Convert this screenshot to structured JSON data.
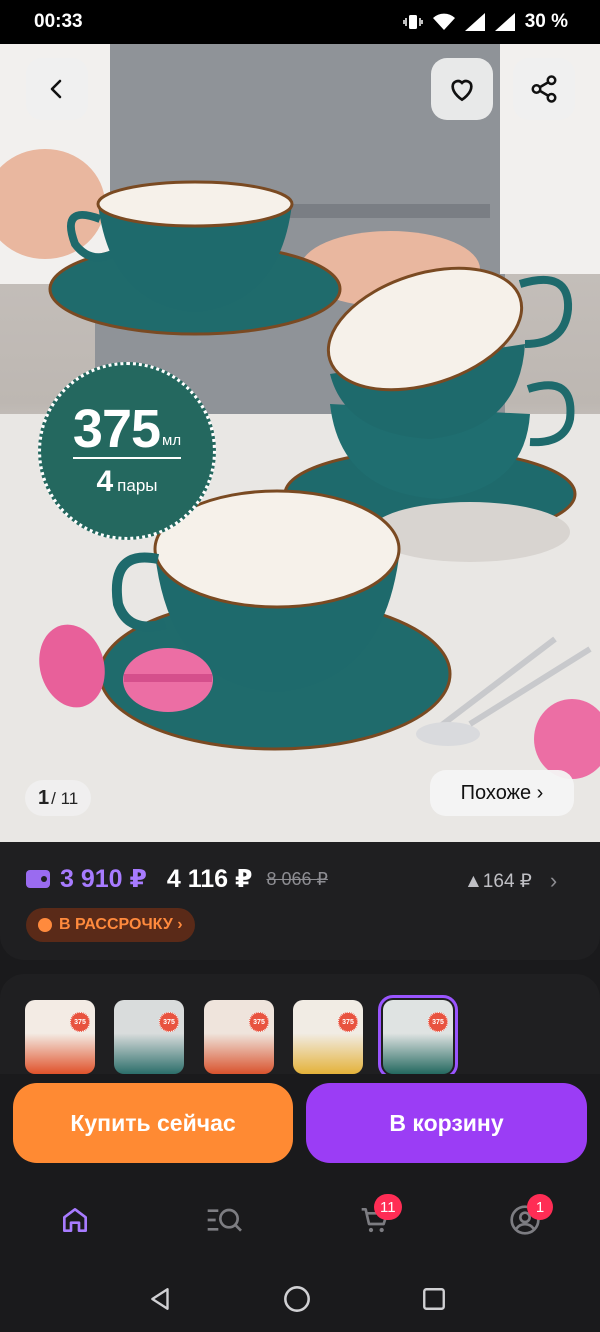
{
  "status_bar": {
    "time": "00:33",
    "battery": "30 %"
  },
  "gallery": {
    "current": "1",
    "total": "/ 11",
    "similar_label": "Похоже ›"
  },
  "badge": {
    "volume": "375",
    "unit": "мл",
    "pairs_count": "4",
    "pairs_label": "пары"
  },
  "price": {
    "wallet_price": "3 910 ₽",
    "regular_price": "4 116 ₽",
    "old_price": "8 066 ₽",
    "difference": "▲164 ₽",
    "installment_label": "В РАССРОЧКУ ›"
  },
  "thumbnails": [
    {
      "tag": "375",
      "colors": [
        "#f3ebe4",
        "#e0522b"
      ],
      "selected": false
    },
    {
      "tag": "375",
      "colors": [
        "#d9dcdc",
        "#2c6e6a"
      ],
      "selected": false
    },
    {
      "tag": "375",
      "colors": [
        "#efe4dc",
        "#d9532e"
      ],
      "selected": false
    },
    {
      "tag": "375",
      "colors": [
        "#f1ece4",
        "#e4b23a"
      ],
      "selected": false
    },
    {
      "tag": "375",
      "colors": [
        "#dfe3e2",
        "#24685f"
      ],
      "selected": true
    }
  ],
  "actions": {
    "buy_now": "Купить сейчас",
    "add_to_cart": "В корзину"
  },
  "bottom_nav": {
    "cart_count": "11",
    "profile_count": "1"
  },
  "colors": {
    "accent_purple": "#9b3df5",
    "accent_orange": "#ff8a33",
    "badge_teal": "#24685f"
  }
}
